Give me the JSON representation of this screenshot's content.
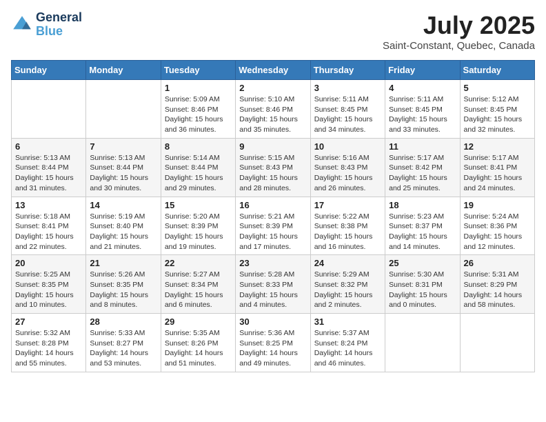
{
  "header": {
    "logo_line1": "General",
    "logo_line2": "Blue",
    "month_title": "July 2025",
    "location": "Saint-Constant, Quebec, Canada"
  },
  "weekdays": [
    "Sunday",
    "Monday",
    "Tuesday",
    "Wednesday",
    "Thursday",
    "Friday",
    "Saturday"
  ],
  "weeks": [
    [
      {
        "day": "",
        "info": ""
      },
      {
        "day": "",
        "info": ""
      },
      {
        "day": "1",
        "info": "Sunrise: 5:09 AM\nSunset: 8:46 PM\nDaylight: 15 hours and 36 minutes."
      },
      {
        "day": "2",
        "info": "Sunrise: 5:10 AM\nSunset: 8:46 PM\nDaylight: 15 hours and 35 minutes."
      },
      {
        "day": "3",
        "info": "Sunrise: 5:11 AM\nSunset: 8:45 PM\nDaylight: 15 hours and 34 minutes."
      },
      {
        "day": "4",
        "info": "Sunrise: 5:11 AM\nSunset: 8:45 PM\nDaylight: 15 hours and 33 minutes."
      },
      {
        "day": "5",
        "info": "Sunrise: 5:12 AM\nSunset: 8:45 PM\nDaylight: 15 hours and 32 minutes."
      }
    ],
    [
      {
        "day": "6",
        "info": "Sunrise: 5:13 AM\nSunset: 8:44 PM\nDaylight: 15 hours and 31 minutes."
      },
      {
        "day": "7",
        "info": "Sunrise: 5:13 AM\nSunset: 8:44 PM\nDaylight: 15 hours and 30 minutes."
      },
      {
        "day": "8",
        "info": "Sunrise: 5:14 AM\nSunset: 8:44 PM\nDaylight: 15 hours and 29 minutes."
      },
      {
        "day": "9",
        "info": "Sunrise: 5:15 AM\nSunset: 8:43 PM\nDaylight: 15 hours and 28 minutes."
      },
      {
        "day": "10",
        "info": "Sunrise: 5:16 AM\nSunset: 8:43 PM\nDaylight: 15 hours and 26 minutes."
      },
      {
        "day": "11",
        "info": "Sunrise: 5:17 AM\nSunset: 8:42 PM\nDaylight: 15 hours and 25 minutes."
      },
      {
        "day": "12",
        "info": "Sunrise: 5:17 AM\nSunset: 8:41 PM\nDaylight: 15 hours and 24 minutes."
      }
    ],
    [
      {
        "day": "13",
        "info": "Sunrise: 5:18 AM\nSunset: 8:41 PM\nDaylight: 15 hours and 22 minutes."
      },
      {
        "day": "14",
        "info": "Sunrise: 5:19 AM\nSunset: 8:40 PM\nDaylight: 15 hours and 21 minutes."
      },
      {
        "day": "15",
        "info": "Sunrise: 5:20 AM\nSunset: 8:39 PM\nDaylight: 15 hours and 19 minutes."
      },
      {
        "day": "16",
        "info": "Sunrise: 5:21 AM\nSunset: 8:39 PM\nDaylight: 15 hours and 17 minutes."
      },
      {
        "day": "17",
        "info": "Sunrise: 5:22 AM\nSunset: 8:38 PM\nDaylight: 15 hours and 16 minutes."
      },
      {
        "day": "18",
        "info": "Sunrise: 5:23 AM\nSunset: 8:37 PM\nDaylight: 15 hours and 14 minutes."
      },
      {
        "day": "19",
        "info": "Sunrise: 5:24 AM\nSunset: 8:36 PM\nDaylight: 15 hours and 12 minutes."
      }
    ],
    [
      {
        "day": "20",
        "info": "Sunrise: 5:25 AM\nSunset: 8:35 PM\nDaylight: 15 hours and 10 minutes."
      },
      {
        "day": "21",
        "info": "Sunrise: 5:26 AM\nSunset: 8:35 PM\nDaylight: 15 hours and 8 minutes."
      },
      {
        "day": "22",
        "info": "Sunrise: 5:27 AM\nSunset: 8:34 PM\nDaylight: 15 hours and 6 minutes."
      },
      {
        "day": "23",
        "info": "Sunrise: 5:28 AM\nSunset: 8:33 PM\nDaylight: 15 hours and 4 minutes."
      },
      {
        "day": "24",
        "info": "Sunrise: 5:29 AM\nSunset: 8:32 PM\nDaylight: 15 hours and 2 minutes."
      },
      {
        "day": "25",
        "info": "Sunrise: 5:30 AM\nSunset: 8:31 PM\nDaylight: 15 hours and 0 minutes."
      },
      {
        "day": "26",
        "info": "Sunrise: 5:31 AM\nSunset: 8:29 PM\nDaylight: 14 hours and 58 minutes."
      }
    ],
    [
      {
        "day": "27",
        "info": "Sunrise: 5:32 AM\nSunset: 8:28 PM\nDaylight: 14 hours and 55 minutes."
      },
      {
        "day": "28",
        "info": "Sunrise: 5:33 AM\nSunset: 8:27 PM\nDaylight: 14 hours and 53 minutes."
      },
      {
        "day": "29",
        "info": "Sunrise: 5:35 AM\nSunset: 8:26 PM\nDaylight: 14 hours and 51 minutes."
      },
      {
        "day": "30",
        "info": "Sunrise: 5:36 AM\nSunset: 8:25 PM\nDaylight: 14 hours and 49 minutes."
      },
      {
        "day": "31",
        "info": "Sunrise: 5:37 AM\nSunset: 8:24 PM\nDaylight: 14 hours and 46 minutes."
      },
      {
        "day": "",
        "info": ""
      },
      {
        "day": "",
        "info": ""
      }
    ]
  ]
}
